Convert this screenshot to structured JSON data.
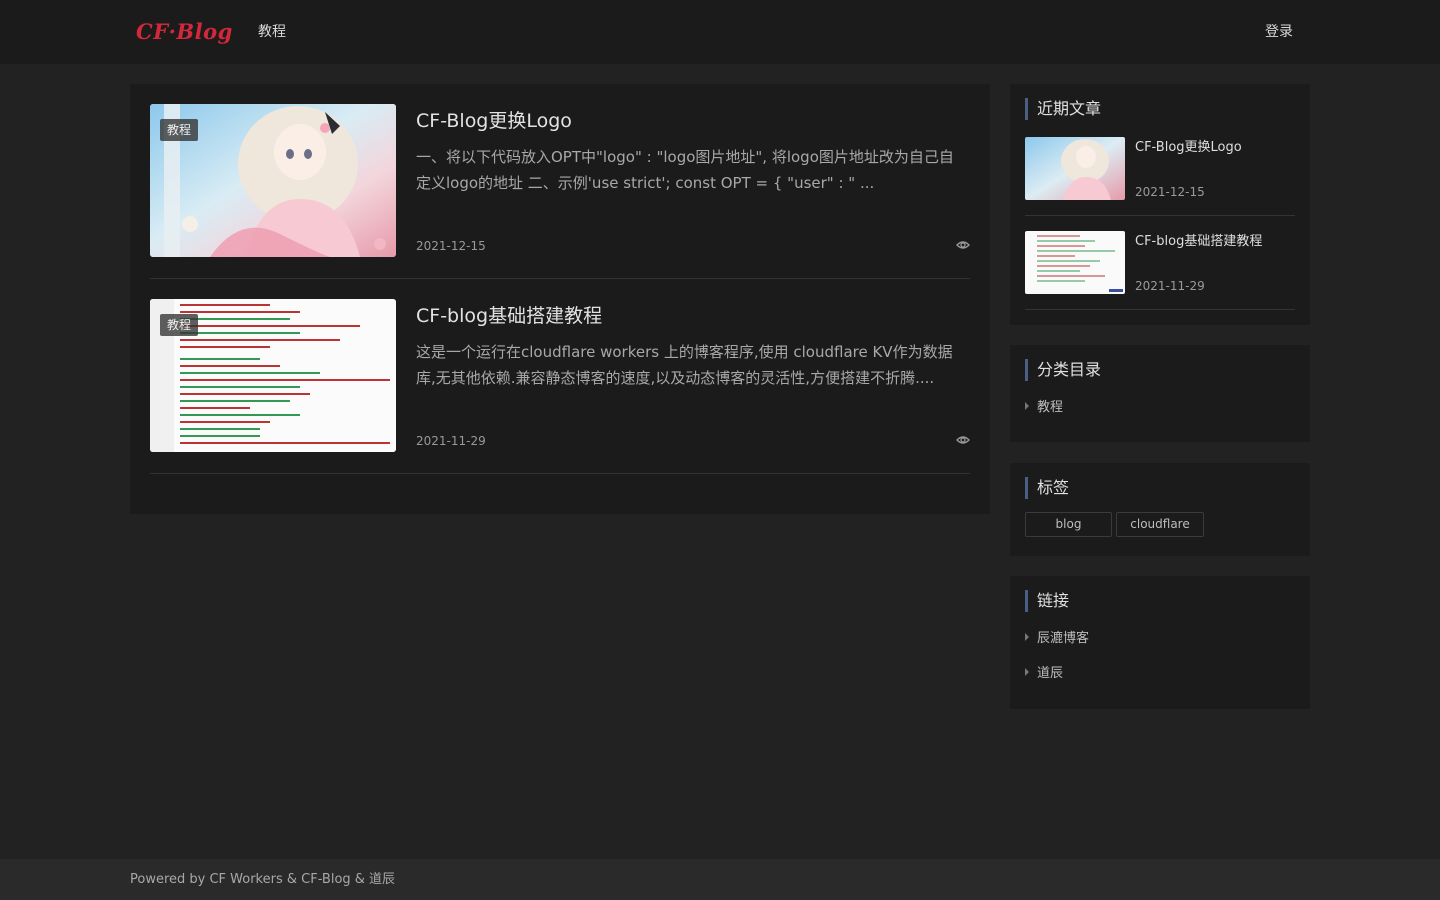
{
  "header": {
    "logo_text": "CF·Blog",
    "nav": {
      "tutorial": "教程",
      "login": "登录"
    }
  },
  "posts": [
    {
      "category": "教程",
      "title": "CF-Blog更换Logo",
      "excerpt": "一、将以下代码放入OPT中\"logo\" : \"logo图片地址\", 将logo图片地址改为自己自定义logo的地址 二、示例'use strict'; const OPT = { \"user\" : \" ...",
      "date": "2021-12-15",
      "thumb_icon": "anime-girl-illustration"
    },
    {
      "category": "教程",
      "title": "CF-blog基础搭建教程",
      "excerpt": "这是一个运行在cloudflare workers 上的博客程序,使用 cloudflare KV作为数据库,无其他依赖.兼容静态博客的速度,以及动态博客的灵活性,方便搭建不折腾....",
      "date": "2021-11-29",
      "thumb_icon": "code-screenshot"
    }
  ],
  "sidebar": {
    "recent": {
      "title": "近期文章",
      "items": [
        {
          "title": "CF-Blog更换Logo",
          "date": "2021-12-15"
        },
        {
          "title": "CF-blog基础搭建教程",
          "date": "2021-11-29"
        }
      ]
    },
    "categories": {
      "title": "分类目录",
      "items": [
        "教程"
      ]
    },
    "tags": {
      "title": "标签",
      "items": [
        "blog",
        "cloudflare"
      ]
    },
    "links": {
      "title": "链接",
      "items": [
        "辰漉博客",
        "道辰"
      ]
    }
  },
  "footer": {
    "text": "Powered by CF Workers & CF-Blog & 道辰"
  },
  "colors": {
    "background": "#222222",
    "card": "#1b1b1b",
    "logo": "#d3283b",
    "accent_bar": "#4a5e86"
  }
}
